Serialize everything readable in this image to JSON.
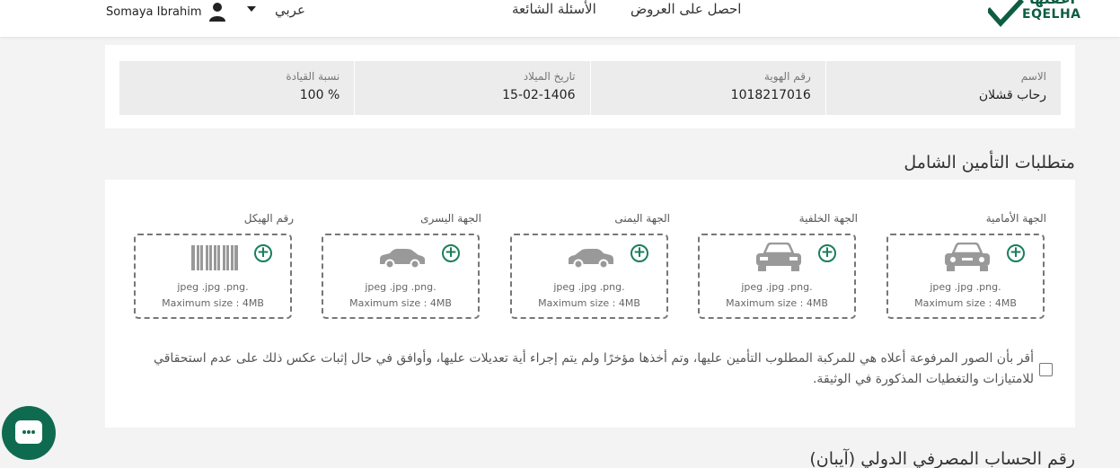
{
  "header": {
    "user_name": "Somaya Ibrahim",
    "language": "عربي",
    "nav_faq": "الأسئلة الشائعة",
    "nav_offers": "احصل على العروض",
    "logo_text": "EQELHA",
    "logo_ar": "اعقلها"
  },
  "driver_info": {
    "cells": [
      {
        "label": "الاسم",
        "value": "رحاب قشلان"
      },
      {
        "label": "رقم الهوية",
        "value": "1018217016"
      },
      {
        "label": "تاريخ الميلاد",
        "value": "15-02-1406"
      },
      {
        "label": "نسبة القيادة",
        "value": "100 %"
      }
    ]
  },
  "insurance": {
    "title": "متطلبات التأمين الشامل",
    "file_types": "jpeg .jpg .png.",
    "max_size": "Maximum size : 4MB",
    "uploads": [
      {
        "label": "الجهة الأمامية",
        "icon": "car-front-icon"
      },
      {
        "label": "الجهة الخلفية",
        "icon": "car-rear-icon"
      },
      {
        "label": "الجهة اليمنى",
        "icon": "car-side-icon"
      },
      {
        "label": "الجهة اليسرى",
        "icon": "car-side-icon"
      },
      {
        "label": "رقم الهيكل",
        "icon": "barcode-icon"
      }
    ],
    "agreement": "أقر بأن الصور المرفوعة أعلاه هي للمركبة المطلوب التأمين عليها، وتم أخذها مؤخرًا ولم يتم إجراء أية تعديلات عليها، وأوافق في حال إثبات عكس ذلك على عدم استحقاقي للامتيازات والتغطيات المذكورة في الوثيقة."
  },
  "iban": {
    "title": "رقم الحساب المصرفي الدولي (آيبان)"
  },
  "colors": {
    "brand_green": "#0f6b4f",
    "card_bg": "#ffffff",
    "page_bg": "#f3f3f3"
  }
}
